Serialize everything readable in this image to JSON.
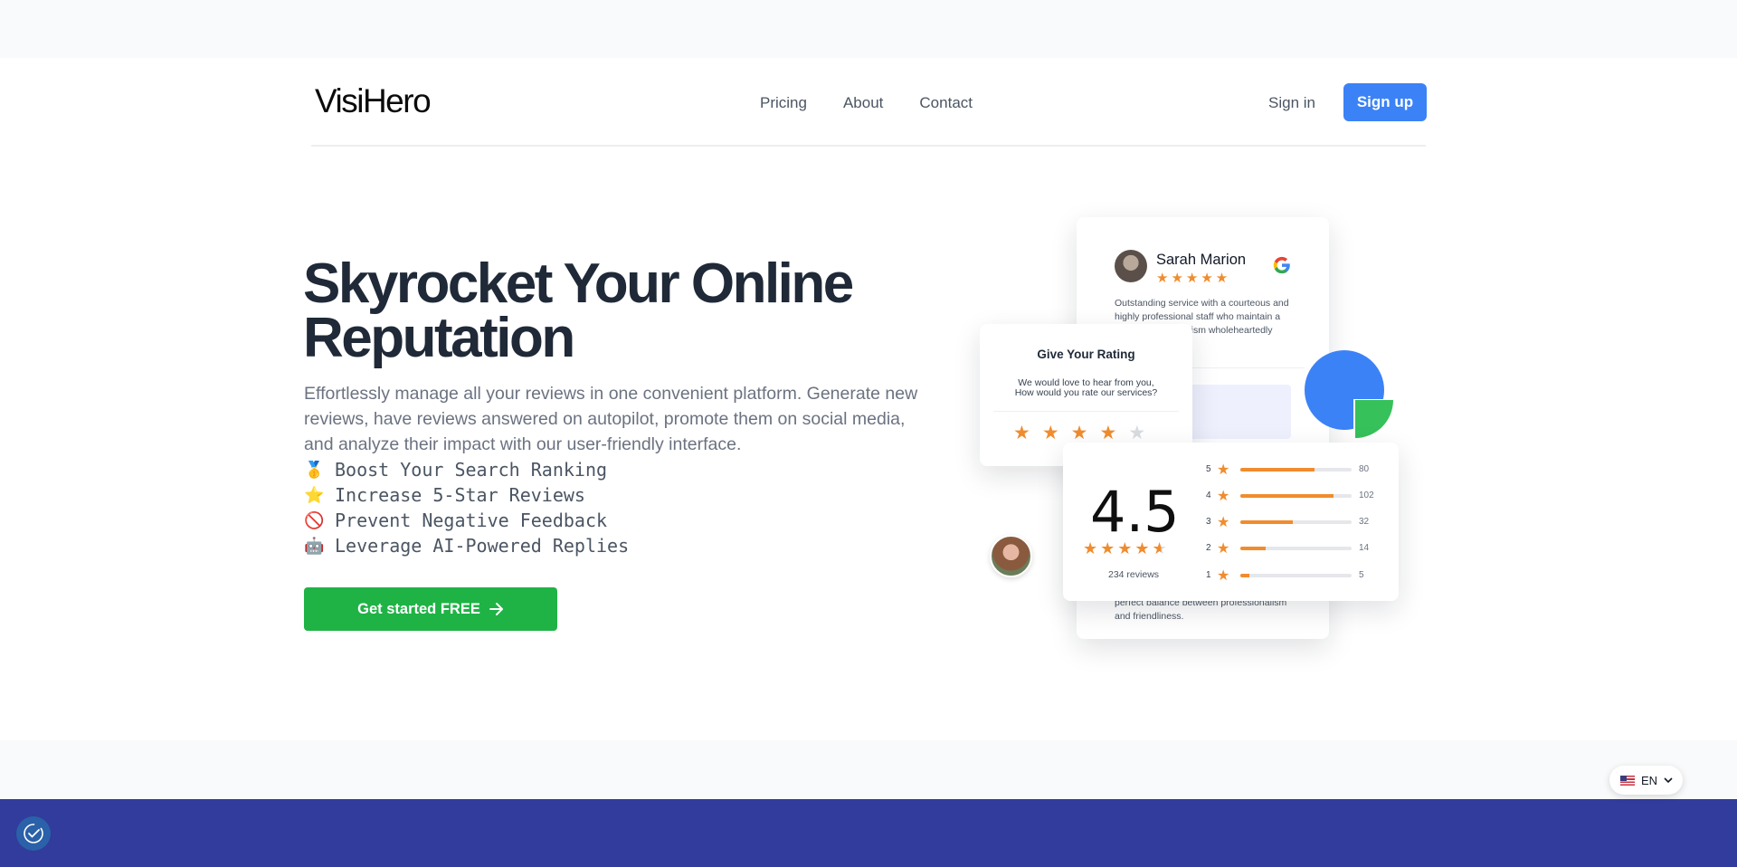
{
  "brand": {
    "logo": "VisiHero"
  },
  "nav": {
    "links": [
      "Pricing",
      "About",
      "Contact"
    ],
    "sign_in": "Sign in",
    "sign_up": "Sign up"
  },
  "hero": {
    "headline": "Skyrocket Your Online Reputation",
    "lead": "Effortlessly manage all your reviews in one convenient platform. Generate new reviews, have reviews answered on autopilot, promote them on social media, and analyze their impact with our user-friendly interface.",
    "features": [
      {
        "icon": "🥇",
        "text": "Boost Your Search Ranking"
      },
      {
        "icon": "⭐",
        "text": "Increase 5-Star Reviews"
      },
      {
        "icon": "🚫",
        "text": "Prevent Negative Feedback"
      },
      {
        "icon": "🤖",
        "text": "Leverage AI-Powered Replies"
      }
    ],
    "cta": "Get started FREE"
  },
  "illustration": {
    "review": {
      "name": "Sarah Marion",
      "stars": 5,
      "text": "Outstanding service with a courteous and highly professional staff who maintain a ween professionalism wholeheartedly",
      "text_bottom": "perfect balance between professionalism and friendliness."
    },
    "rating_prompt": {
      "title": "Give Your Rating",
      "subtitle_line1": "We would love to hear from you,",
      "subtitle_line2": "How would you rate our services?",
      "filled_stars": 4,
      "total_stars": 5
    },
    "summary": {
      "score": "4.5",
      "reviews_label": "234 reviews",
      "distribution": [
        {
          "stars": "5",
          "count": "80",
          "fraction": 0.67
        },
        {
          "stars": "4",
          "count": "102",
          "fraction": 0.84
        },
        {
          "stars": "3",
          "count": "32",
          "fraction": 0.47
        },
        {
          "stars": "2",
          "count": "14",
          "fraction": 0.23
        },
        {
          "stars": "1",
          "count": "5",
          "fraction": 0.08
        }
      ]
    }
  },
  "language": {
    "code": "EN"
  },
  "colors": {
    "primary": "#3b82f6",
    "cta": "#1fb346",
    "star": "#f08c2e",
    "footer": "#313c9c"
  }
}
